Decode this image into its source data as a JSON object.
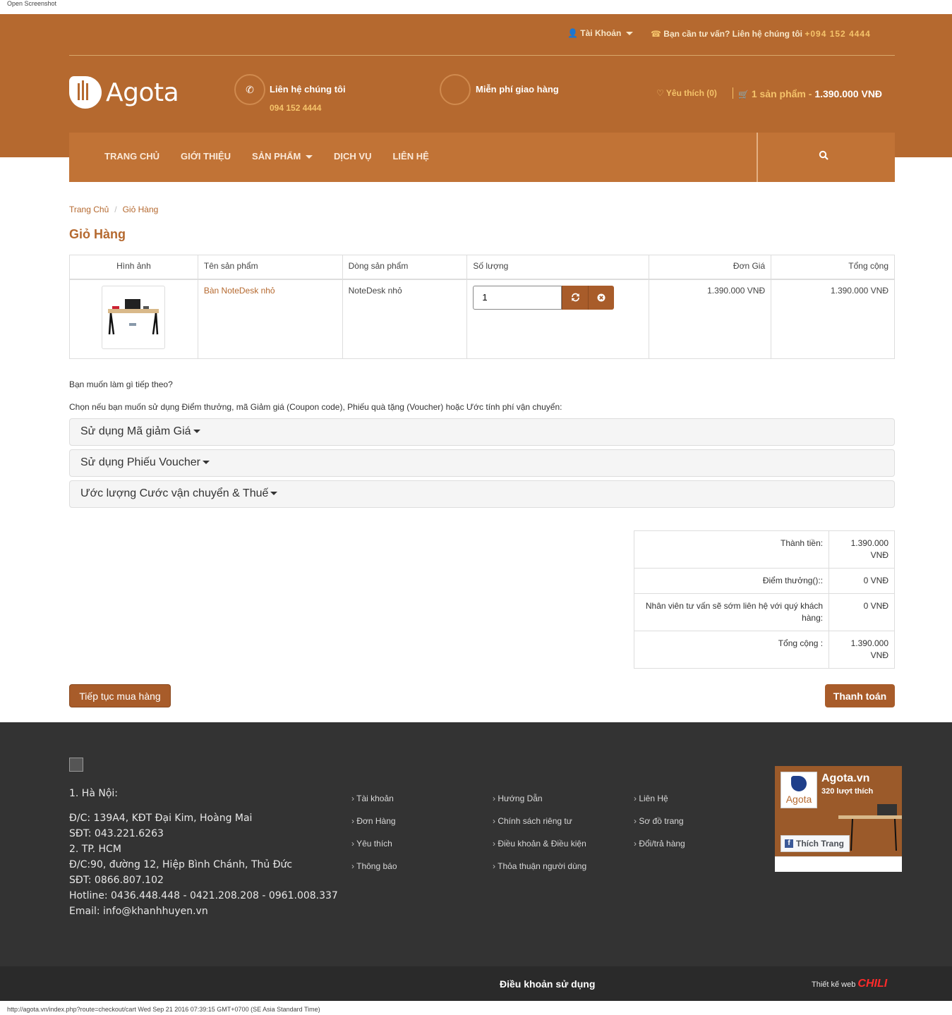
{
  "browser": {
    "caption": "Open Screenshot",
    "status": "http://agota.vn/index.php?route=checkout/cart Wed Sep 21 2016 07:39:15 GMT+0700 (SE Asia Standard Time)"
  },
  "topbar": {
    "account": "Tài Khoản",
    "advice": "Bạn cần tư vấn? Liên hệ chúng tôi ",
    "advice_phone": "+094  152  4444"
  },
  "header": {
    "logo": "Agota",
    "contact_label": "Liên hệ chúng tôi",
    "contact_phone": "094 152 4444",
    "shipping": "Miễn phí giao hàng",
    "wishlist": "Yêu thích (0)",
    "cart_count": "1 sản phẩm - ",
    "cart_total": "1.390.000 VNĐ"
  },
  "nav": {
    "items": [
      "TRANG CHỦ",
      "GIỚI THIỆU",
      "SẢN PHẨM",
      "DỊCH VỤ",
      "LIÊN HỆ"
    ]
  },
  "breadcrumb": [
    "Trang Chủ",
    "Giỏ Hàng"
  ],
  "page_title": "Giỏ Hàng",
  "cart_table": {
    "headers": [
      "Hình ảnh",
      "Tên sản phẩm",
      "Dòng sản phẩm",
      "Số lượng",
      "Đơn Giá",
      "Tổng cộng"
    ],
    "rows": [
      {
        "name": "Bàn NoteDesk nhỏ",
        "model": "NoteDesk nhỏ",
        "quantity": "1",
        "unit_price": "1.390.000 VNĐ",
        "total": "1.390.000 VNĐ"
      }
    ]
  },
  "next_question": "Bạn muốn làm gì tiếp theo?",
  "choose_text": "Chọn nếu bạn muốn sử dụng Điểm thưởng, mã Giảm giá (Coupon code), Phiếu quà tặng (Voucher) hoặc Ước tính phí vận chuyển:",
  "panels": [
    "Sử dụng Mã giảm Giá",
    "Sử dụng Phiếu Voucher",
    "Ước lượng Cước vận chuyển & Thuế"
  ],
  "totals": [
    {
      "label": "Thành tiền:",
      "value": "1.390.000 VNĐ"
    },
    {
      "label": "Điểm thưởng()::",
      "value": "0 VNĐ"
    },
    {
      "label": "Nhân viên tư vấn sẽ sớm liên hệ với quý khách hàng:",
      "value": "0 VNĐ"
    },
    {
      "label": "Tổng cộng :",
      "value": "1.390.000 VNĐ"
    }
  ],
  "buttons": {
    "continue": "Tiếp tục mua hàng",
    "checkout": "Thanh toán"
  },
  "footer": {
    "address_lines": [
      "1. Hà Nội:",
      "Đ/C: 139A4, KĐT Đại Kim, Hoàng Mai",
      "SĐT: 043.221.6263",
      "2. TP. HCM",
      "Đ/C:90, đường 12, Hiệp Bình Chánh, Thủ Đức",
      "SĐT: 0866.807.102",
      "Hotline: 0436.448.448 - 0421.208.208 - 0961.008.337",
      "Email: info@khanhhuyen.vn"
    ],
    "col1": [
      "Tài khoản",
      "Đơn Hàng",
      "Yêu thích",
      "Thông báo"
    ],
    "col2": [
      "Hướng Dẫn",
      "Chính sách riêng tư",
      "Điều khoản & Điều kiện",
      "Thỏa thuận người dùng"
    ],
    "col3": [
      "Liên Hệ",
      "Sơ đồ trang",
      "Đổi/trả hàng"
    ],
    "fb": {
      "name": "Agota.vn",
      "likes": "320 lượt thích",
      "logo": "Agota",
      "like_button": "Thích Trang"
    },
    "terms": "Điều khoản sử dụng",
    "design": "Thiết kế web ",
    "design_brand": "CHILI"
  },
  "colors": {
    "brand": "#b5692f",
    "nav": "#c17336",
    "footer": "#333333",
    "accent": "#f5c36a"
  }
}
